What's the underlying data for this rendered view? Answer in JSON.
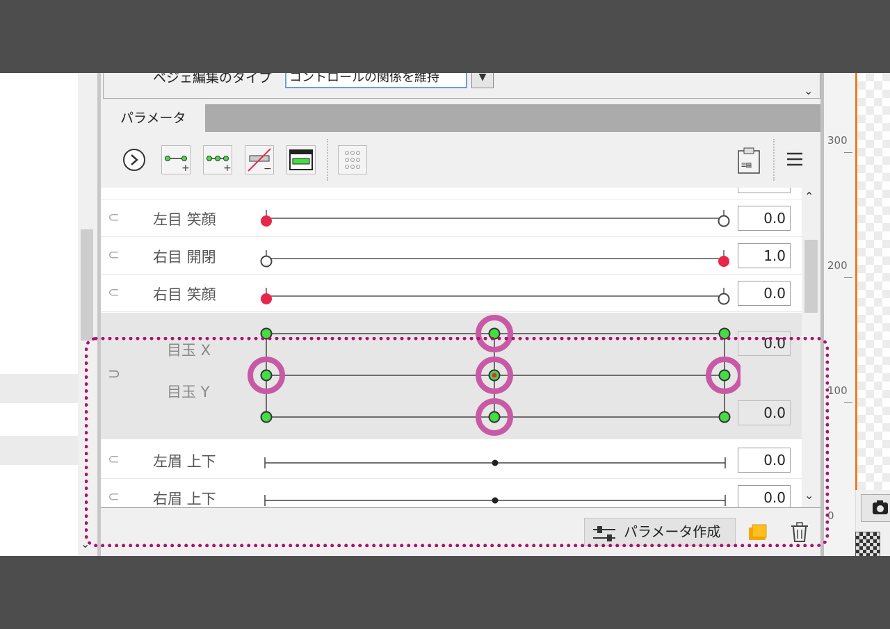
{
  "top_panel": {
    "edit_type_label": "ベジェ編集のタイプ",
    "edit_type_value": "コントロールの関係を維持"
  },
  "tab": {
    "label": "パラメータ"
  },
  "toolbar": {
    "buttons": [
      {
        "icon": "circle-arrow-right-icon"
      },
      {
        "icon": "add-key-two-icon"
      },
      {
        "icon": "add-key-three-icon"
      },
      {
        "icon": "remove-key-icon"
      },
      {
        "icon": "key-window-icon"
      },
      {
        "icon": "key-grid-icon"
      }
    ],
    "right_icons": [
      "clipboard-icon",
      "menu-icon"
    ]
  },
  "parameters": [
    {
      "name": "左目 笑顔",
      "value": "0.0",
      "active_key": "left"
    },
    {
      "name": "右目 開閉",
      "value": "1.0",
      "active_key": "right"
    },
    {
      "name": "右目 笑顔",
      "value": "0.0",
      "active_key": "left"
    },
    {
      "name_x": "目玉 X",
      "name_y": "目玉 Y",
      "value_x": "0.0",
      "value_y": "0.0",
      "grid": true
    },
    {
      "name": "左眉 上下",
      "value": "0.0"
    },
    {
      "name": "右眉 上下",
      "value": "0.0"
    }
  ],
  "bottom": {
    "create_label": "パラメータ作成"
  },
  "ruler": {
    "ticks": [
      "300",
      "200",
      "100",
      "0"
    ]
  },
  "colors": {
    "highlight": "#b0106e",
    "highlight_ring": "#c85aa5",
    "key_active": "#e8264a",
    "key_grid": "#44dd44",
    "canvas_border": "#f47b20"
  }
}
